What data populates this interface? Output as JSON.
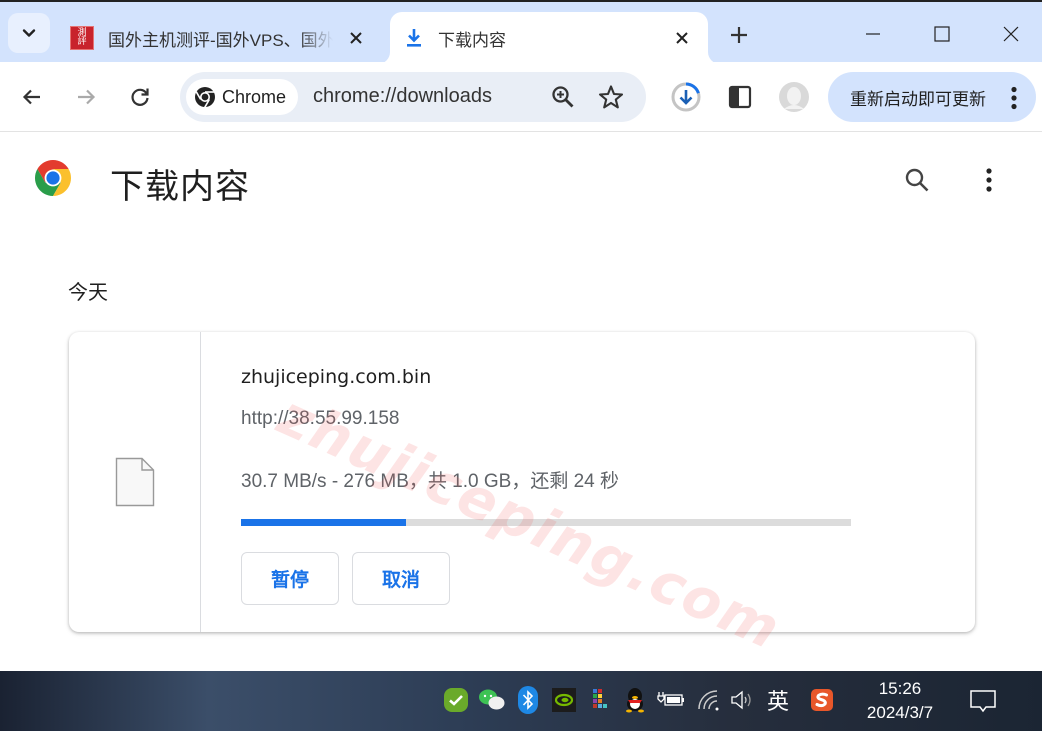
{
  "tabs": [
    {
      "title": "国外主机测评-国外VPS、国外",
      "favicon": "site-seal-icon",
      "active": false
    },
    {
      "title": "下载内容",
      "favicon": "download-icon",
      "active": true
    }
  ],
  "window_controls": {
    "minimize": "minimize-icon",
    "maximize": "maximize-icon",
    "close": "close-icon"
  },
  "toolbar": {
    "chip_label": "Chrome",
    "url": "chrome://downloads",
    "update_button": "重新启动即可更新"
  },
  "page": {
    "title": "下载内容",
    "section": "今天",
    "download": {
      "file_name": "zhujiceping.com.bin",
      "url": "http://38.55.99.158",
      "status": "30.7 MB/s - 276 MB，共 1.0 GB，还剩 24 秒",
      "progress_percent": 27,
      "pause_label": "暂停",
      "cancel_label": "取消"
    },
    "watermark": "zhujiceping.com"
  },
  "taskbar": {
    "ime": "英",
    "time": "15:26",
    "date": "2024/3/7",
    "tray_icons": [
      "security-check-icon",
      "wechat-icon",
      "bluetooth-icon",
      "nvidia-icon",
      "color-grid-icon",
      "qq-icon",
      "battery-plug-icon",
      "wifi-icon",
      "volume-icon",
      "ime-icon",
      "sogou-icon"
    ]
  },
  "colors": {
    "accent": "#1a73e8",
    "tabstrip": "#d3e3fd",
    "omnibox": "#e9eef6",
    "progress_track": "#dcdcdc"
  }
}
